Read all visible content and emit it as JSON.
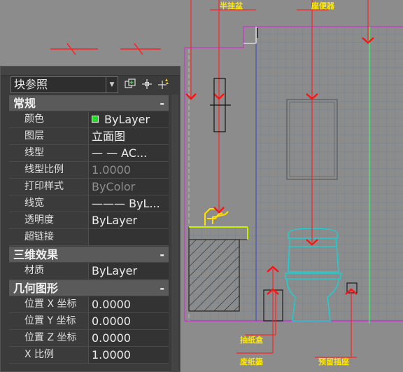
{
  "drawing": {
    "labels": {
      "basin": "半挂盆",
      "toilet": "座便器",
      "tissue_box": "抽纸盒",
      "waste_basket": "废纸篓",
      "socket": "预留插座"
    }
  },
  "palette": {
    "selector_value": "块参照",
    "sections": {
      "general": "常规",
      "three_d": "三维效果",
      "geometry": "几何图形"
    },
    "collapse_symbol": "-",
    "general_rows": [
      {
        "name": "颜色",
        "value": "ByLayer"
      },
      {
        "name": "图层",
        "value": "立面图"
      },
      {
        "name": "线型",
        "value": "—    — AC..."
      },
      {
        "name": "线型比例",
        "value": "1.0000"
      },
      {
        "name": "打印样式",
        "value": "ByColor"
      },
      {
        "name": "线宽",
        "value": "——— ByL..."
      },
      {
        "name": "透明度",
        "value": "ByLayer"
      },
      {
        "name": "超链接",
        "value": ""
      }
    ],
    "three_d_rows": [
      {
        "name": "材质",
        "value": "ByLayer"
      }
    ],
    "geometry_rows": [
      {
        "name": "位置 X 坐标",
        "value": "0.0000"
      },
      {
        "name": "位置 Y 坐标",
        "value": "0.0000"
      },
      {
        "name": "位置 Z 坐标",
        "value": "0.0000"
      },
      {
        "name": "X 比例",
        "value": "1.0000"
      }
    ],
    "color_swatch": "#22dd22"
  }
}
